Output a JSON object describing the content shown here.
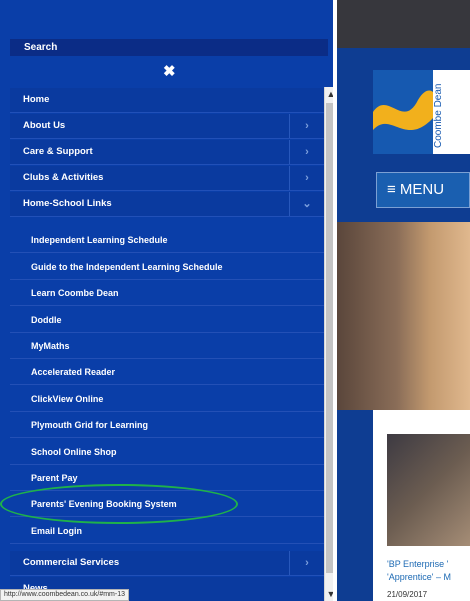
{
  "menu": {
    "search_label": "Search",
    "close_glyph": "✖",
    "top_items": [
      {
        "label": "Home",
        "has_submenu": false
      },
      {
        "label": "About Us",
        "has_submenu": true
      },
      {
        "label": "Care & Support",
        "has_submenu": true
      },
      {
        "label": "Clubs & Activities",
        "has_submenu": true
      },
      {
        "label": "Home-School Links",
        "has_submenu": true,
        "expanded": true
      }
    ],
    "chevron_right": "›",
    "chevron_down": "⌄",
    "sub_items": [
      "Independent Learning Schedule",
      "Guide to the Independent Learning Schedule",
      "Learn Coombe Dean",
      "Doddle",
      "MyMaths",
      "Accelerated Reader",
      "ClickView Online",
      "Plymouth Grid for Learning",
      "School Online Shop",
      "Parent Pay",
      "Parents' Evening Booking System",
      "Email Login"
    ],
    "bottom_items": [
      {
        "label": "Commercial Services",
        "has_submenu": true
      },
      {
        "label": "News",
        "has_submenu": false
      }
    ]
  },
  "site": {
    "logo_text": "Coombe Dean",
    "menu_button_label": "≡ MENU",
    "news_title_line1": "'BP Enterprise '",
    "news_title_line2": "'Apprentice' – M",
    "news_date": "21/09/2017"
  },
  "status_url": "http://www.coombedean.co.uk/#mm-13",
  "colors": {
    "menu_bg": "#0a3ea8",
    "highlight_ellipse": "#1fb24a",
    "logo_gold": "#f2b01c",
    "logo_blue": "#1659b0"
  }
}
